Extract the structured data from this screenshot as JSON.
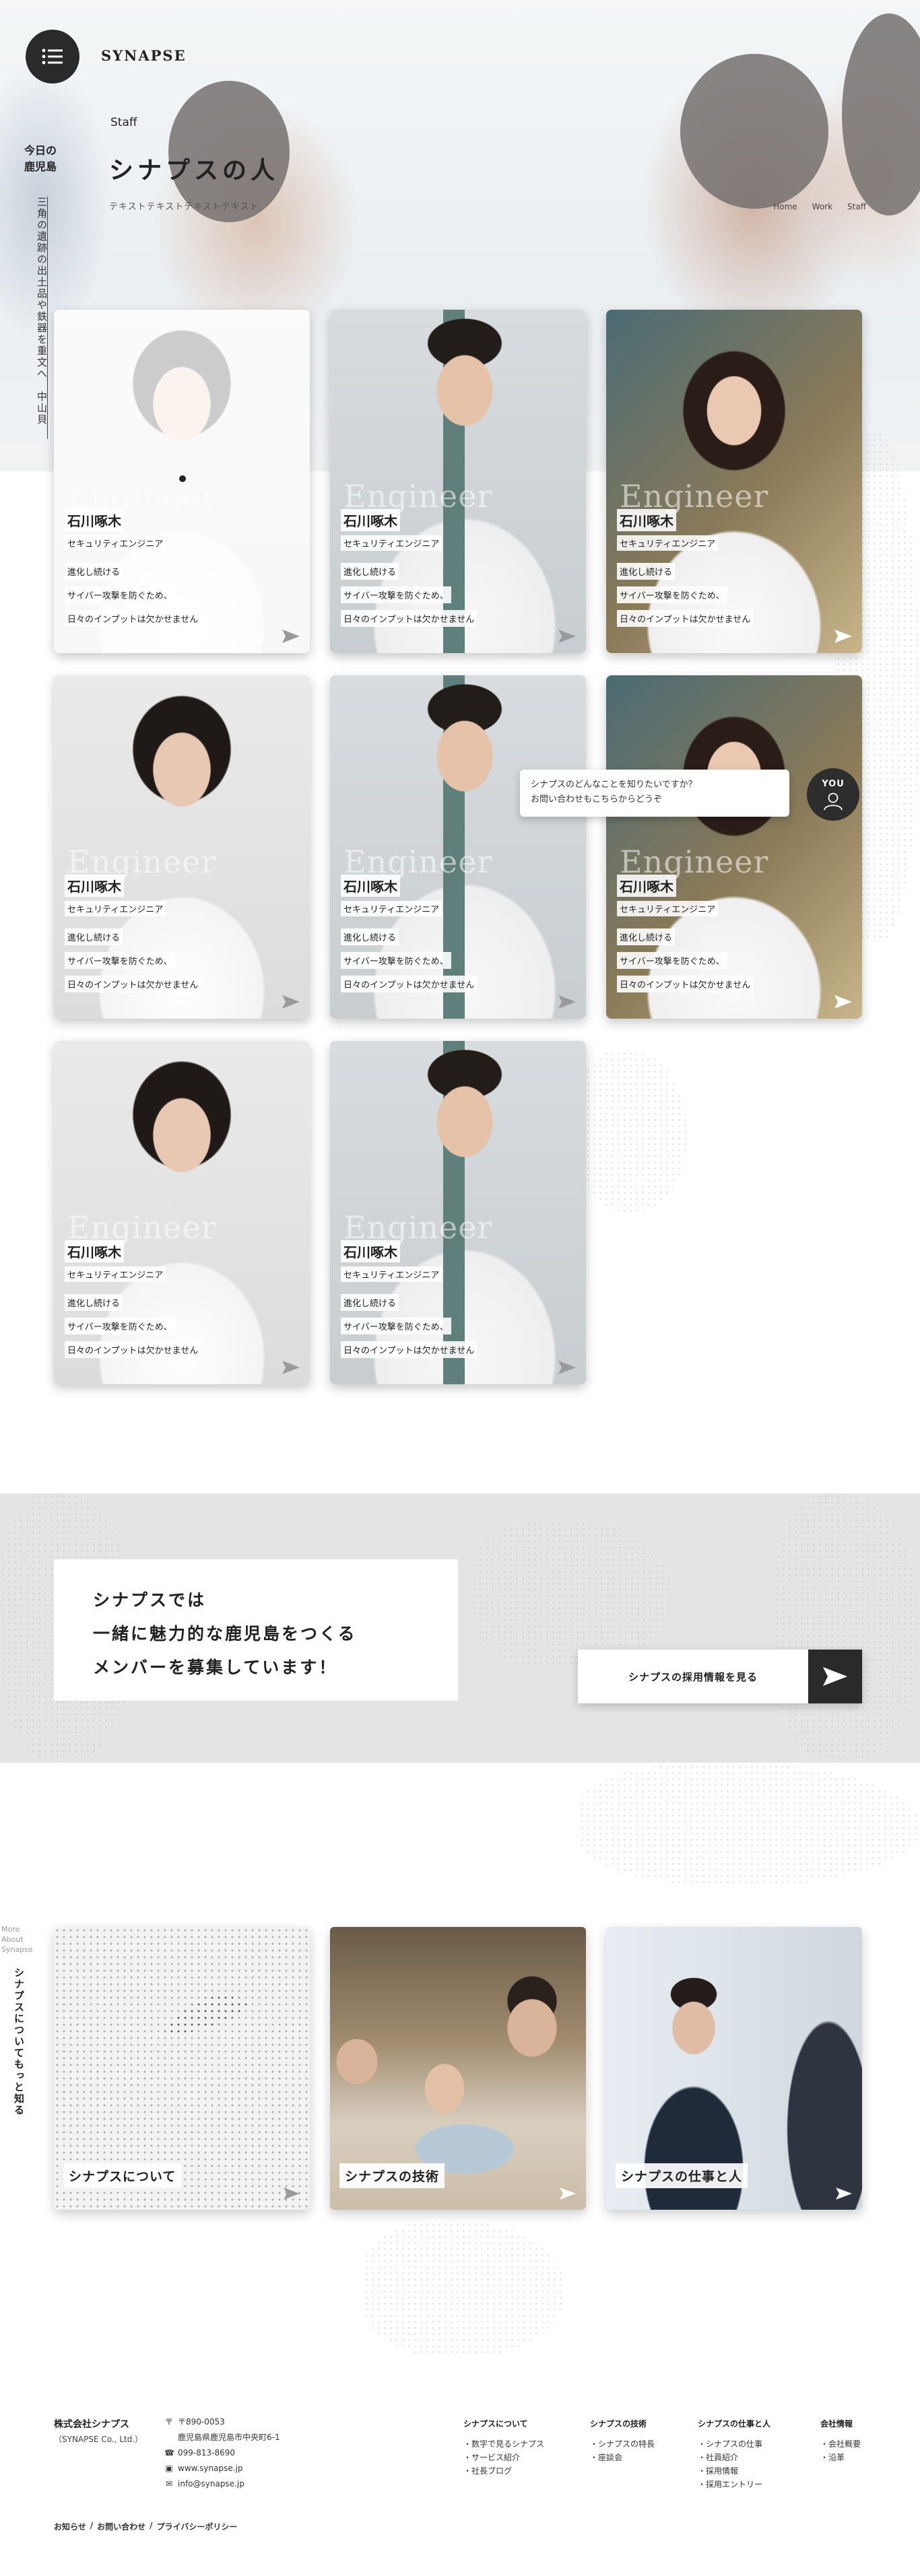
{
  "header": {
    "logo": "SYNAPSE",
    "section_label": "Staff",
    "title": "シナプスの人",
    "subtitle": "テキストテキストテキストテキスト",
    "breadcrumb": [
      "Home",
      "Work",
      "Staff"
    ]
  },
  "ticker": {
    "label_line1": "今日の",
    "label_line2": "鹿児島",
    "text": "三角の遺跡の出土品や鉄器を重文へ　中山貝塚"
  },
  "staff_cards": [
    {
      "name": "石川啄木",
      "role": "セキュリティエンジニア",
      "lines": [
        "進化し続ける",
        "サイバー攻撃を防ぐため、",
        "日々のインプットは欠かせません"
      ],
      "watermark": "Engineer"
    },
    {
      "name": "石川啄木",
      "role": "セキュリティエンジニア",
      "lines": [
        "進化し続ける",
        "サイバー攻撃を防ぐため、",
        "日々のインプットは欠かせません"
      ],
      "watermark": "Engineer"
    },
    {
      "name": "石川啄木",
      "role": "セキュリティエンジニア",
      "lines": [
        "進化し続ける",
        "サイバー攻撃を防ぐため、",
        "日々のインプットは欠かせません"
      ],
      "watermark": "Engineer"
    },
    {
      "name": "石川啄木",
      "role": "セキュリティエンジニア",
      "lines": [
        "進化し続ける",
        "サイバー攻撃を防ぐため、",
        "日々のインプットは欠かせません"
      ],
      "watermark": "Engineer"
    },
    {
      "name": "石川啄木",
      "role": "セキュリティエンジニア",
      "lines": [
        "進化し続ける",
        "サイバー攻撃を防ぐため、",
        "日々のインプットは欠かせません"
      ],
      "watermark": "Engineer"
    },
    {
      "name": "石川啄木",
      "role": "セキュリティエンジニア",
      "lines": [
        "進化し続ける",
        "サイバー攻撃を防ぐため、",
        "日々のインプットは欠かせません"
      ],
      "watermark": "Engineer"
    },
    {
      "name": "石川啄木",
      "role": "セキュリティエンジニア",
      "lines": [
        "進化し続ける",
        "サイバー攻撃を防ぐため、",
        "日々のインプットは欠かせません"
      ],
      "watermark": "Engineer"
    },
    {
      "name": "石川啄木",
      "role": "セキュリティエンジニア",
      "lines": [
        "進化し続ける",
        "サイバー攻撃を防ぐため、",
        "日々のインプットは欠かせません"
      ],
      "watermark": "Engineer"
    }
  ],
  "chat": {
    "line1": "シナプスのどんなことを知りたいですか？",
    "line2": "お問い合わせもこちらからどうぞ",
    "badge": "YOU"
  },
  "recruit": {
    "line1": "シナプスでは",
    "line2": "一緒に魅力的な鹿児島をつくる",
    "line3": "メンバーを募集しています！",
    "cta": "シナプスの採用情報を見る"
  },
  "about": {
    "side_small": [
      "More",
      "About",
      "Synapse"
    ],
    "vertical": "シナプスについてもっと知る",
    "cards": [
      "シナプスについて",
      "シナプスの技術",
      "シナプスの仕事と人"
    ]
  },
  "footer": {
    "company": "株式会社シナプス",
    "company_en": "（SYNAPSE Co., Ltd.）",
    "postal": "〒890-0053",
    "address": "鹿児島県鹿児島市中央町6-1",
    "phone": "099-813-8690",
    "web": "www.synapse.jp",
    "email": "info@synapse.jp",
    "columns": [
      {
        "heading": "シナプスについて",
        "items": [
          "・数字で見るシナプス",
          "・サービス紹介",
          "・社長ブログ"
        ]
      },
      {
        "heading": "シナプスの技術",
        "items": [
          "・シナプスの特長",
          "・座談会"
        ]
      },
      {
        "heading": "シナプスの仕事と人",
        "items": [
          "・シナプスの仕事",
          "・社員紹介",
          "・採用情報",
          "・採用エントリー"
        ]
      },
      {
        "heading": "会社情報",
        "items": [
          "・会社概要",
          "・沿革"
        ]
      }
    ],
    "bottom_links": [
      "お知らせ",
      "お問い合わせ",
      "プライバシーポリシー"
    ],
    "separator": "/"
  }
}
